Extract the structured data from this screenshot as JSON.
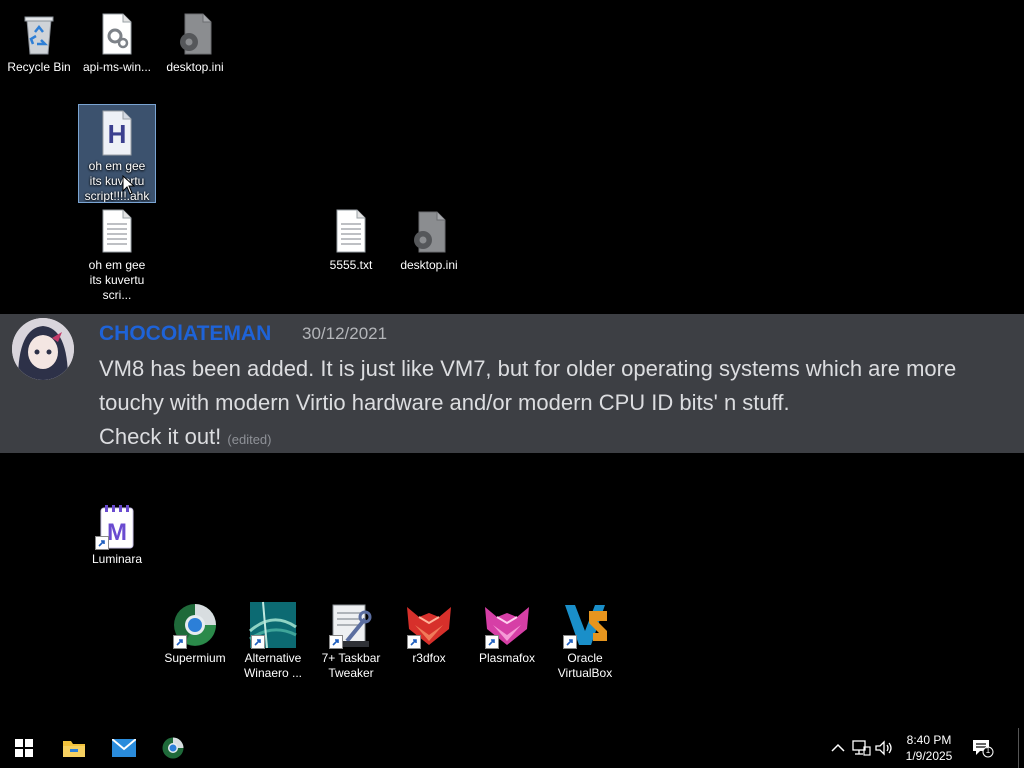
{
  "desktop_icons": {
    "recycle_bin": "Recycle Bin",
    "api_ms_win": "api-ms-win...",
    "desktop_ini_1": "desktop.ini",
    "ahk_script_selected": "oh em gee its kuvertu script!!!!.ahk",
    "text_file": "oh em gee its kuvertu scri...",
    "txt_5555": "5555.txt",
    "desktop_ini_2": "desktop.ini",
    "luminara": "Luminara",
    "supermium": "Supermium",
    "alt_winaero": "Alternative Winaero ...",
    "taskbar_tweaker": "7+ Taskbar Tweaker",
    "r3dfox": "r3dfox",
    "plasmafox": "Plasmafox",
    "oracle_vbox": "Oracle VirtualBox"
  },
  "message": {
    "username": "CHOCOlATEMAN",
    "timestamp": "30/12/2021",
    "line1": "VM8 has been added. It is just like VM7, but for older operating systems which are more",
    "line2": "touchy with modern Virtio hardware and/or modern CPU ID bits' n stuff.",
    "line3": "Check it out!",
    "edited": "(edited)"
  },
  "taskbar": {
    "time": "8:40 PM",
    "date": "1/9/2025",
    "notification_count": "1"
  },
  "colors": {
    "username": "#1e63d8",
    "banner_bg": "#3d3f44",
    "desktop_bg": "#000000"
  }
}
